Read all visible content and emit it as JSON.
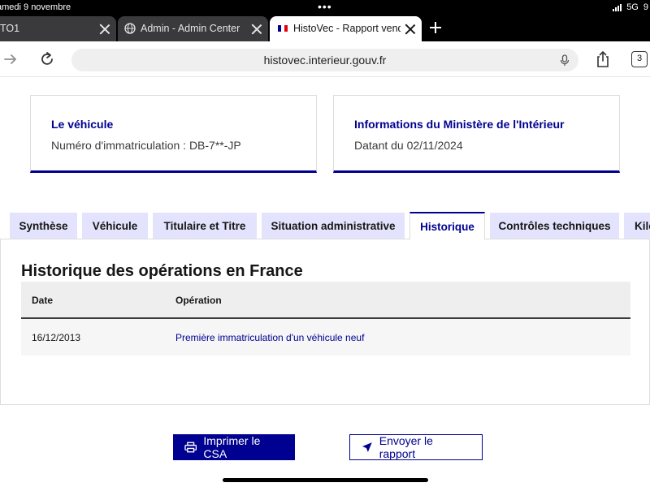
{
  "status_bar": {
    "date": "amedi 9 novembre",
    "network": "5G",
    "battery": "9"
  },
  "browser": {
    "tabs": [
      {
        "title": "TO1",
        "active": false
      },
      {
        "title": "Admin - Admin Center",
        "active": false
      },
      {
        "title": "HistoVec - Rapport vende",
        "active": true
      }
    ],
    "url": "histovec.interieur.gouv.fr",
    "tab_count": "3"
  },
  "cards": [
    {
      "title": "Le véhicule",
      "text": "Numéro d'immatriculation : DB-7**-JP"
    },
    {
      "title": "Informations du Ministère de l'Intérieur",
      "text": "Datant du 02/11/2024"
    }
  ],
  "nav_tabs": [
    "Synthèse",
    "Véhicule",
    "Titulaire et Titre",
    "Situation administrative",
    "Historique",
    "Contrôles techniques",
    "Kilo"
  ],
  "section": {
    "title": "Historique des opérations en France",
    "columns": [
      "Date",
      "Opération"
    ],
    "rows": [
      {
        "date": "16/12/2013",
        "operation": "Première immatriculation d'un véhicule neuf"
      }
    ]
  },
  "actions": {
    "print": "Imprimer le CSA",
    "send": "Envoyer le rapport"
  },
  "colors": {
    "brand_blue": "#000091",
    "tab_bg": "#e3e3fd"
  }
}
